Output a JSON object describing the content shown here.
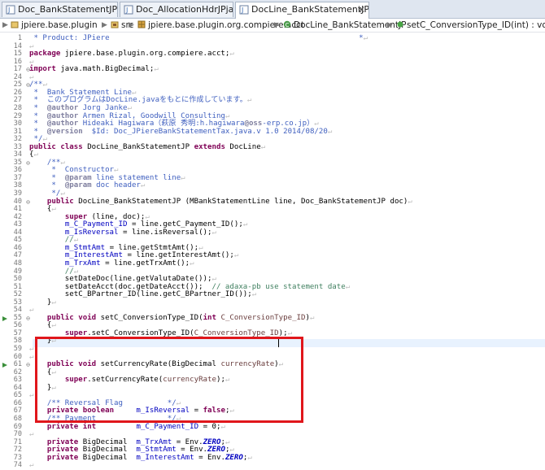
{
  "tabs": [
    {
      "label": "Doc_BankStatementJPjava",
      "active": false
    },
    {
      "label": "Doc_AllocationHdrJPjava",
      "active": false
    },
    {
      "label": "DocLine_BankStatementJPjava",
      "active": true,
      "close": "✕"
    }
  ],
  "breadcrumb": {
    "items": [
      "jpiere.base.plugin",
      "src",
      "jpiere.base.plugin.org.compiere.acct",
      "DocLine_BankStatementJP",
      "setC_ConversionType_ID(int) : void"
    ]
  },
  "editor": {
    "lines": [
      {
        "n": "1",
        "t": "jd",
        "s": " * Product: JPiere                                                        *"
      },
      {
        "n": "14",
        "t": "eol",
        "s": ""
      },
      {
        "n": "15",
        "t": "pkg",
        "s": "package jpiere.base.plugin.org.compiere.acct;"
      },
      {
        "n": "16",
        "t": "eol",
        "s": ""
      },
      {
        "n": "17",
        "t": "imp",
        "s": "import java.math.BigDecimal;"
      },
      {
        "n": "24",
        "t": "eol",
        "s": ""
      },
      {
        "n": "25",
        "t": "jd",
        "s": "/**"
      },
      {
        "n": "26",
        "t": "jd",
        "s": " *  Bank Statement Line"
      },
      {
        "n": "27",
        "t": "jd",
        "s": " *  このプログラムはDocLine.javaをもとに作成しています。"
      },
      {
        "n": "28",
        "t": "jd",
        "s": " *  @author Jorg Janke"
      },
      {
        "n": "29",
        "t": "jd",
        "s": " *  @author Armen Rizal, Goodwill Consulting"
      },
      {
        "n": "30",
        "t": "jd",
        "s": " *  @author Hideaki Hagiwara（萩原 秀明:h.hagiwara@oss-erp.co.jp）"
      },
      {
        "n": "31",
        "t": "jd",
        "s": " *  @version  $Id: Doc_JPiereBankStatementTax.java.v 1.0 2014/08/20"
      },
      {
        "n": "32",
        "t": "jd",
        "s": " */"
      },
      {
        "n": "33",
        "t": "cls",
        "s": "public class DocLine_BankStatementJP extends DocLine"
      },
      {
        "n": "34",
        "t": "plain",
        "s": "{"
      },
      {
        "n": "35",
        "t": "jd",
        "s": "    /**"
      },
      {
        "n": "36",
        "t": "jd",
        "s": "     *  Constructor"
      },
      {
        "n": "37",
        "t": "jd",
        "s": "     *  @param line statement line"
      },
      {
        "n": "38",
        "t": "jd",
        "s": "     *  @param doc header"
      },
      {
        "n": "39",
        "t": "jd",
        "s": "     */"
      },
      {
        "n": "40",
        "t": "ctor",
        "s": "    public DocLine_BankStatementJP (MBankStatementLine line, Doc_BankStatementJP doc)"
      },
      {
        "n": "41",
        "t": "plain",
        "s": "    {"
      },
      {
        "n": "42",
        "t": "sup",
        "s": "        super (line, doc);"
      },
      {
        "n": "43",
        "t": "asg",
        "s": "        m_C_Payment_ID = line.getC_Payment_ID();"
      },
      {
        "n": "44",
        "t": "asg",
        "s": "        m_IsReversal = line.isReversal();"
      },
      {
        "n": "45",
        "t": "cm",
        "s": "        //"
      },
      {
        "n": "46",
        "t": "asg",
        "s": "        m_StmtAmt = line.getStmtAmt();"
      },
      {
        "n": "47",
        "t": "asg",
        "s": "        m_InterestAmt = line.getInterestAmt();"
      },
      {
        "n": "48",
        "t": "asg",
        "s": "        m_TrxAmt = line.getTrxAmt();"
      },
      {
        "n": "49",
        "t": "cm",
        "s": "        //"
      },
      {
        "n": "50",
        "t": "plain",
        "s": "        setDateDoc(line.getValutaDate());"
      },
      {
        "n": "51",
        "t": "acct",
        "s": "        setDateAcct(doc.getDateAcct());  // adaxa-pb use statement date"
      },
      {
        "n": "52",
        "t": "plain",
        "s": "        setC_BPartner_ID(line.getC_BPartner_ID());"
      },
      {
        "n": "53",
        "t": "plain",
        "s": "    }"
      },
      {
        "n": "54",
        "t": "eol",
        "s": ""
      },
      {
        "n": "55",
        "t": "m1",
        "s": "    public void setC_ConversionType_ID(int C_ConversionType_ID)"
      },
      {
        "n": "56",
        "t": "plain",
        "s": "    {"
      },
      {
        "n": "57",
        "t": "m1b",
        "s": "        super.setC_ConversionType_ID(C_ConversionType_ID);"
      },
      {
        "n": "58",
        "t": "plain",
        "s": "    }"
      },
      {
        "n": "59",
        "t": "eol",
        "s": ""
      },
      {
        "n": "60",
        "t": "eol",
        "s": ""
      },
      {
        "n": "61",
        "t": "m2",
        "s": "    public void setCurrencyRate(BigDecimal currencyRate)"
      },
      {
        "n": "62",
        "t": "plain",
        "s": "    {"
      },
      {
        "n": "63",
        "t": "m2b",
        "s": "        super.setCurrencyRate(currencyRate);"
      },
      {
        "n": "64",
        "t": "plain",
        "s": "    }"
      },
      {
        "n": "65",
        "t": "eol",
        "s": ""
      },
      {
        "n": "66",
        "t": "jd",
        "s": "    /** Reversal Flag          */"
      },
      {
        "n": "67",
        "t": "f1",
        "s": "    private boolean     m_IsReversal = false;"
      },
      {
        "n": "68",
        "t": "jd",
        "s": "    /** Payment                */"
      },
      {
        "n": "69",
        "t": "f2",
        "s": "    private int         m_C_Payment_ID = 0;"
      },
      {
        "n": "70",
        "t": "eol",
        "s": ""
      },
      {
        "n": "71",
        "t": "f3",
        "s": "    private BigDecimal  m_TrxAmt = Env.ZERO;"
      },
      {
        "n": "72",
        "t": "f3",
        "s": "    private BigDecimal  m_StmtAmt = Env.ZERO;"
      },
      {
        "n": "73",
        "t": "f3",
        "s": "    private BigDecimal  m_InterestAmt = Env.ZERO;"
      },
      {
        "n": "74",
        "t": "eol",
        "s": ""
      }
    ]
  },
  "colors": {
    "keyword": "#7f0055",
    "comment": "#3f7f5f",
    "javadoc": "#3f5fbf",
    "field": "#0000c0",
    "highlight_box": "#e0161b"
  }
}
